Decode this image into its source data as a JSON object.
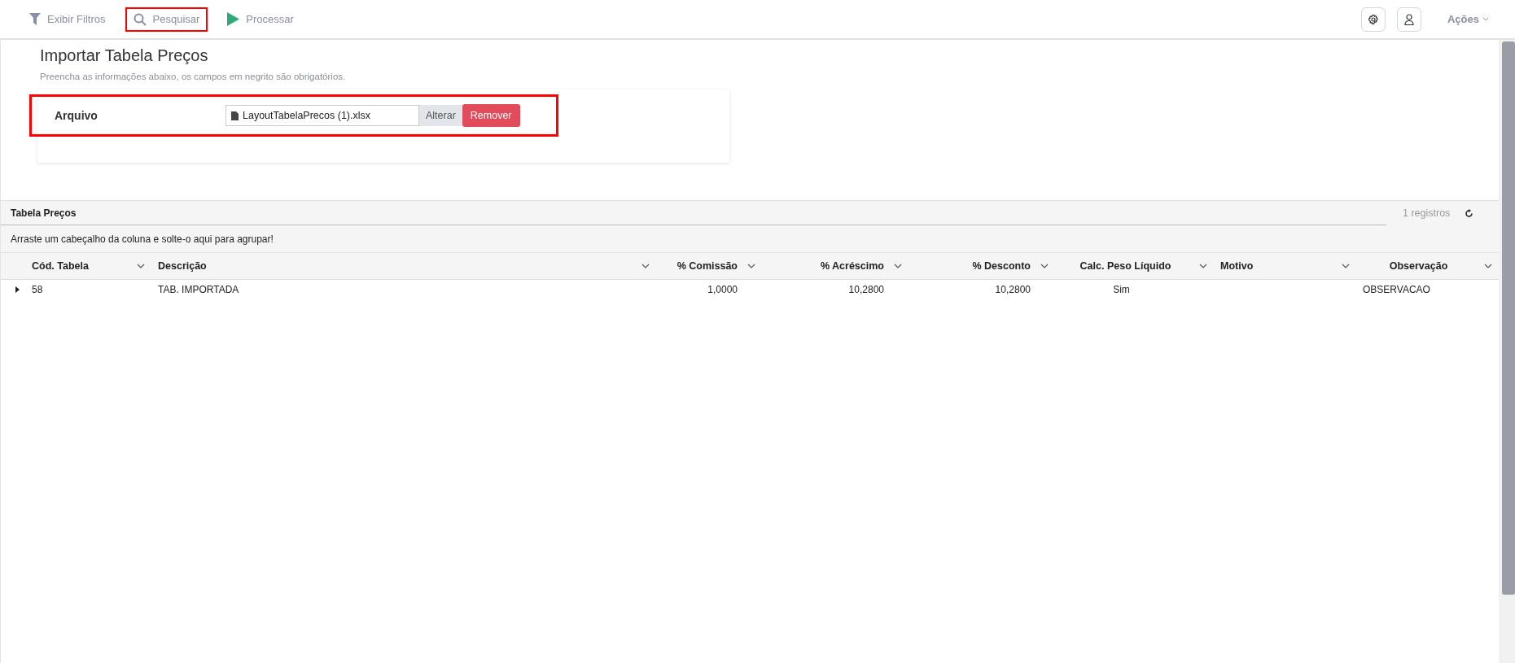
{
  "toolbar": {
    "items": [
      {
        "kind": "filter",
        "label": "Exibir Filtros",
        "highlighted": false
      },
      {
        "kind": "search",
        "label": "Pesquisar",
        "highlighted": true
      },
      {
        "kind": "play",
        "label": "Processar",
        "highlighted": false
      }
    ],
    "actions_label": "Ações"
  },
  "form": {
    "title": "Importar Tabela Preços",
    "subtitle": "Preencha as informações abaixo, os campos em negrito são obrigatórios.",
    "fields": [
      {
        "label": "Arquivo",
        "value": "LayoutTabelaPrecos (1).xlsx",
        "change_button": "Alterar",
        "remove_button": "Remover",
        "highlighted": true
      }
    ]
  },
  "grid": {
    "title": "Tabela Preços",
    "record_count": "1 registros",
    "group_hint": "Arraste um cabeçalho da coluna e solte-o aqui para agrupar!",
    "columns": [
      {
        "label": "Cód. Tabela"
      },
      {
        "label": "Descrição"
      },
      {
        "label": "% Comissão"
      },
      {
        "label": "% Acréscimo"
      },
      {
        "label": "% Desconto"
      },
      {
        "label": "Calc. Peso Líquido"
      },
      {
        "label": "Motivo"
      },
      {
        "label": "Observação"
      }
    ],
    "rows": [
      {
        "expanded": false,
        "cells": [
          "58",
          "TAB. IMPORTADA",
          "1,0000",
          "10,2800",
          "10,2800",
          "Sim",
          "",
          "OBSERVACAO"
        ]
      }
    ]
  }
}
